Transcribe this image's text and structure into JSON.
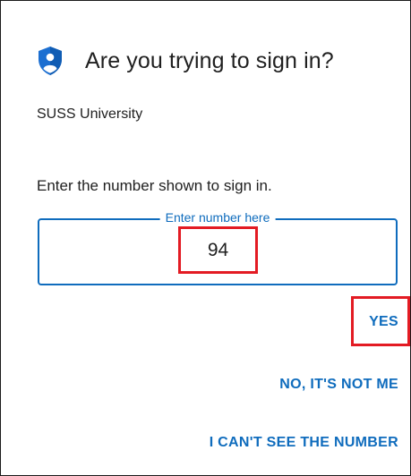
{
  "prompt": {
    "icon": "authenticator-lock-icon",
    "title": "Are you trying to sign in?",
    "organization": "SUSS University",
    "instruction": "Enter the number shown to sign in.",
    "field_label": "Enter number here",
    "number_value": "94"
  },
  "actions": {
    "yes": "YES",
    "no": "NO, IT'S NOT ME",
    "cant_see": "I CAN'T SEE THE NUMBER"
  },
  "colors": {
    "accent": "#0f6cbd",
    "highlight": "#e31b23",
    "text": "#1f1f1f"
  }
}
